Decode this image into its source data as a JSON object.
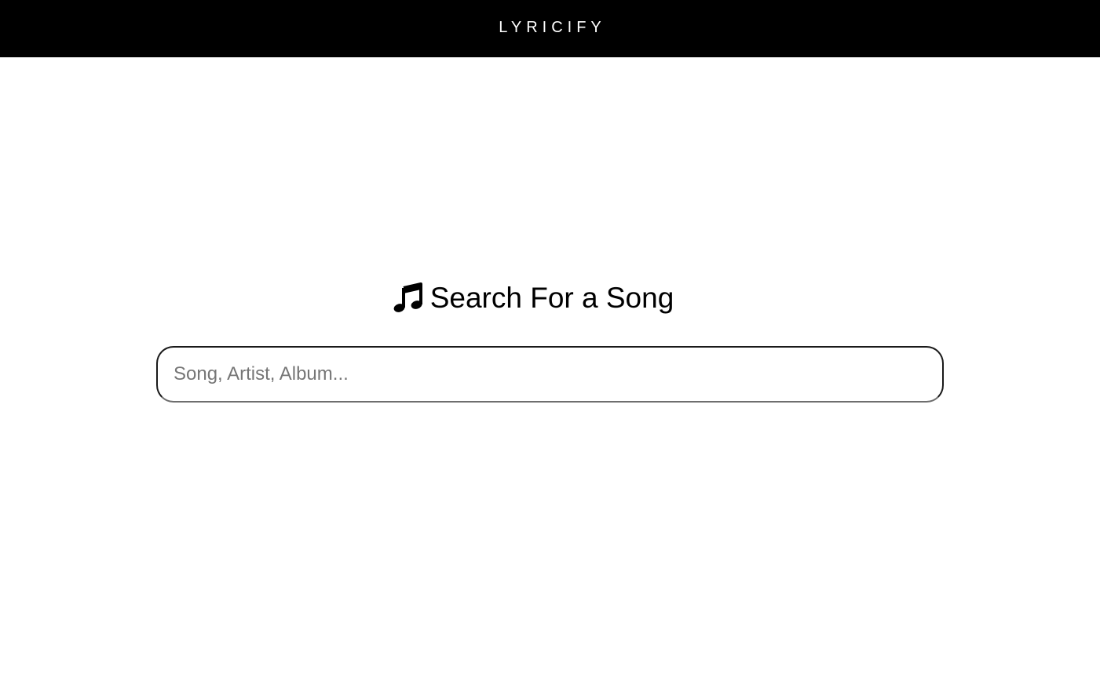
{
  "header": {
    "brand": "LYRICIFY"
  },
  "main": {
    "heading": "Search For a Song",
    "heading_icon": "music-note-icon"
  },
  "search": {
    "placeholder": "Song, Artist, Album...",
    "value": ""
  },
  "colors": {
    "topbar_background": "#000000",
    "brand_text": "#ffffff",
    "page_background": "#ffffff",
    "input_border": "#1a1a1a",
    "placeholder_text": "#767676"
  }
}
